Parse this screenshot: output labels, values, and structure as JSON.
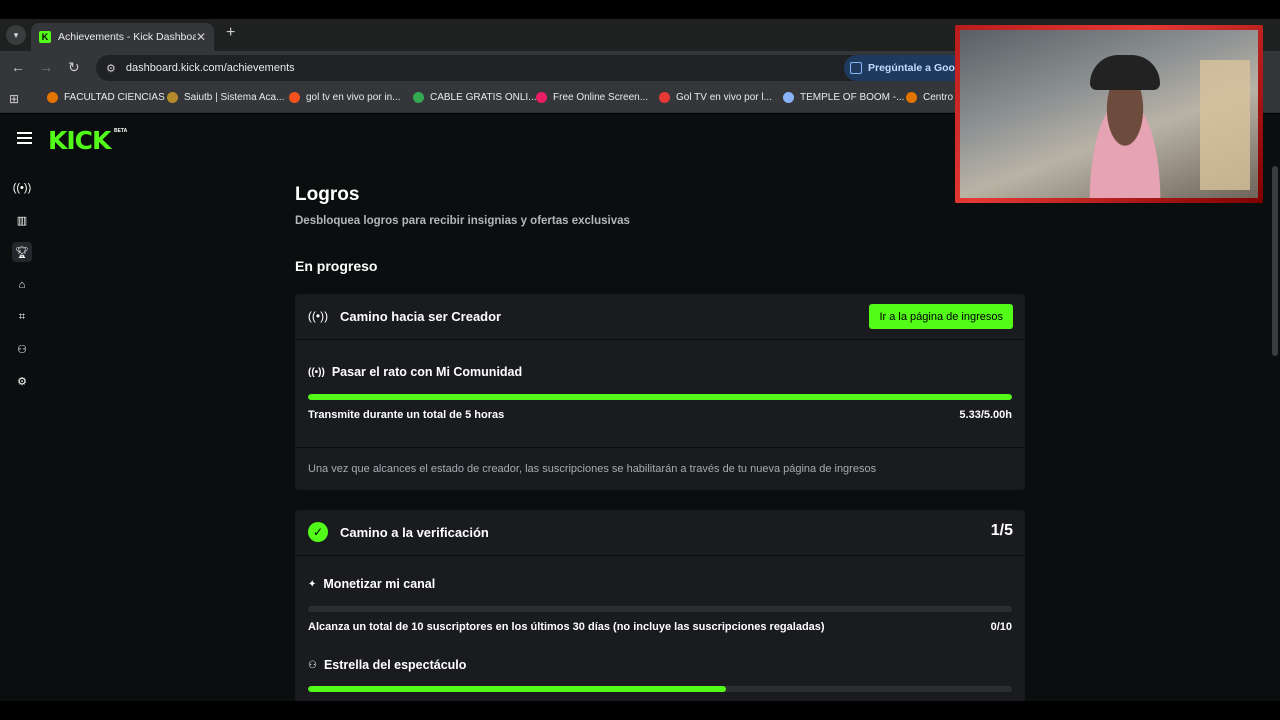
{
  "browser": {
    "tab_title": "Achievements - Kick Dashboard",
    "url": "dashboard.kick.com/achievements",
    "ask_google": "Pregúntale a Goog",
    "bookmarks": [
      {
        "label": "FACULTAD CIENCIAS",
        "color": "#e37400"
      },
      {
        "label": "Saiutb | Sistema Aca...",
        "color": "#b58b2a"
      },
      {
        "label": "gol tv en vivo por in...",
        "color": "#f4511e"
      },
      {
        "label": "CABLE GRATIS ONLI...",
        "color": "#34a853"
      },
      {
        "label": "Free Online Screen...",
        "color": "#e91e63"
      },
      {
        "label": "Gol TV en vivo por l...",
        "color": "#e53935"
      },
      {
        "label": "TEMPLE OF BOOM -...",
        "color": "#8ab4f8"
      },
      {
        "label": "Centro e",
        "color": "#e37400"
      }
    ]
  },
  "kick": {
    "logo": "KICK",
    "logo_badge": "BETA",
    "accent": "#53fc18"
  },
  "sidebar": {
    "icons": [
      "broadcast-icon",
      "chart-icon",
      "trophy-icon",
      "community-icon",
      "stream-icon",
      "users-icon",
      "gear-icon"
    ]
  },
  "main": {
    "title": "Logros",
    "subtitle": "Desbloquea logros para recibir insignias y ofertas exclusivas",
    "section": "En progreso",
    "card1": {
      "title": "Camino hacia ser Creador",
      "button": "Ir a la página de ingresos",
      "task": {
        "title": "Pasar el rato con Mi Comunidad",
        "progress": 1.0,
        "desc": "Transmite durante un total de 5 horas",
        "value": "5.33/5.00h"
      },
      "note": "Una vez que alcances el estado de creador, las suscripciones se habilitarán a través de tu nueva página de ingresos"
    },
    "card2": {
      "title": "Camino a la verificación",
      "counter": "1/5",
      "task1": {
        "title": "Monetizar mi canal",
        "progress": 0.0,
        "desc": "Alcanza un total de 10 suscriptores en los últimos 30 días (no incluye las suscripciones regaladas)",
        "value": "0/10"
      },
      "task2": {
        "title": "Estrella del espectáculo",
        "progress": 0.594
      }
    }
  }
}
